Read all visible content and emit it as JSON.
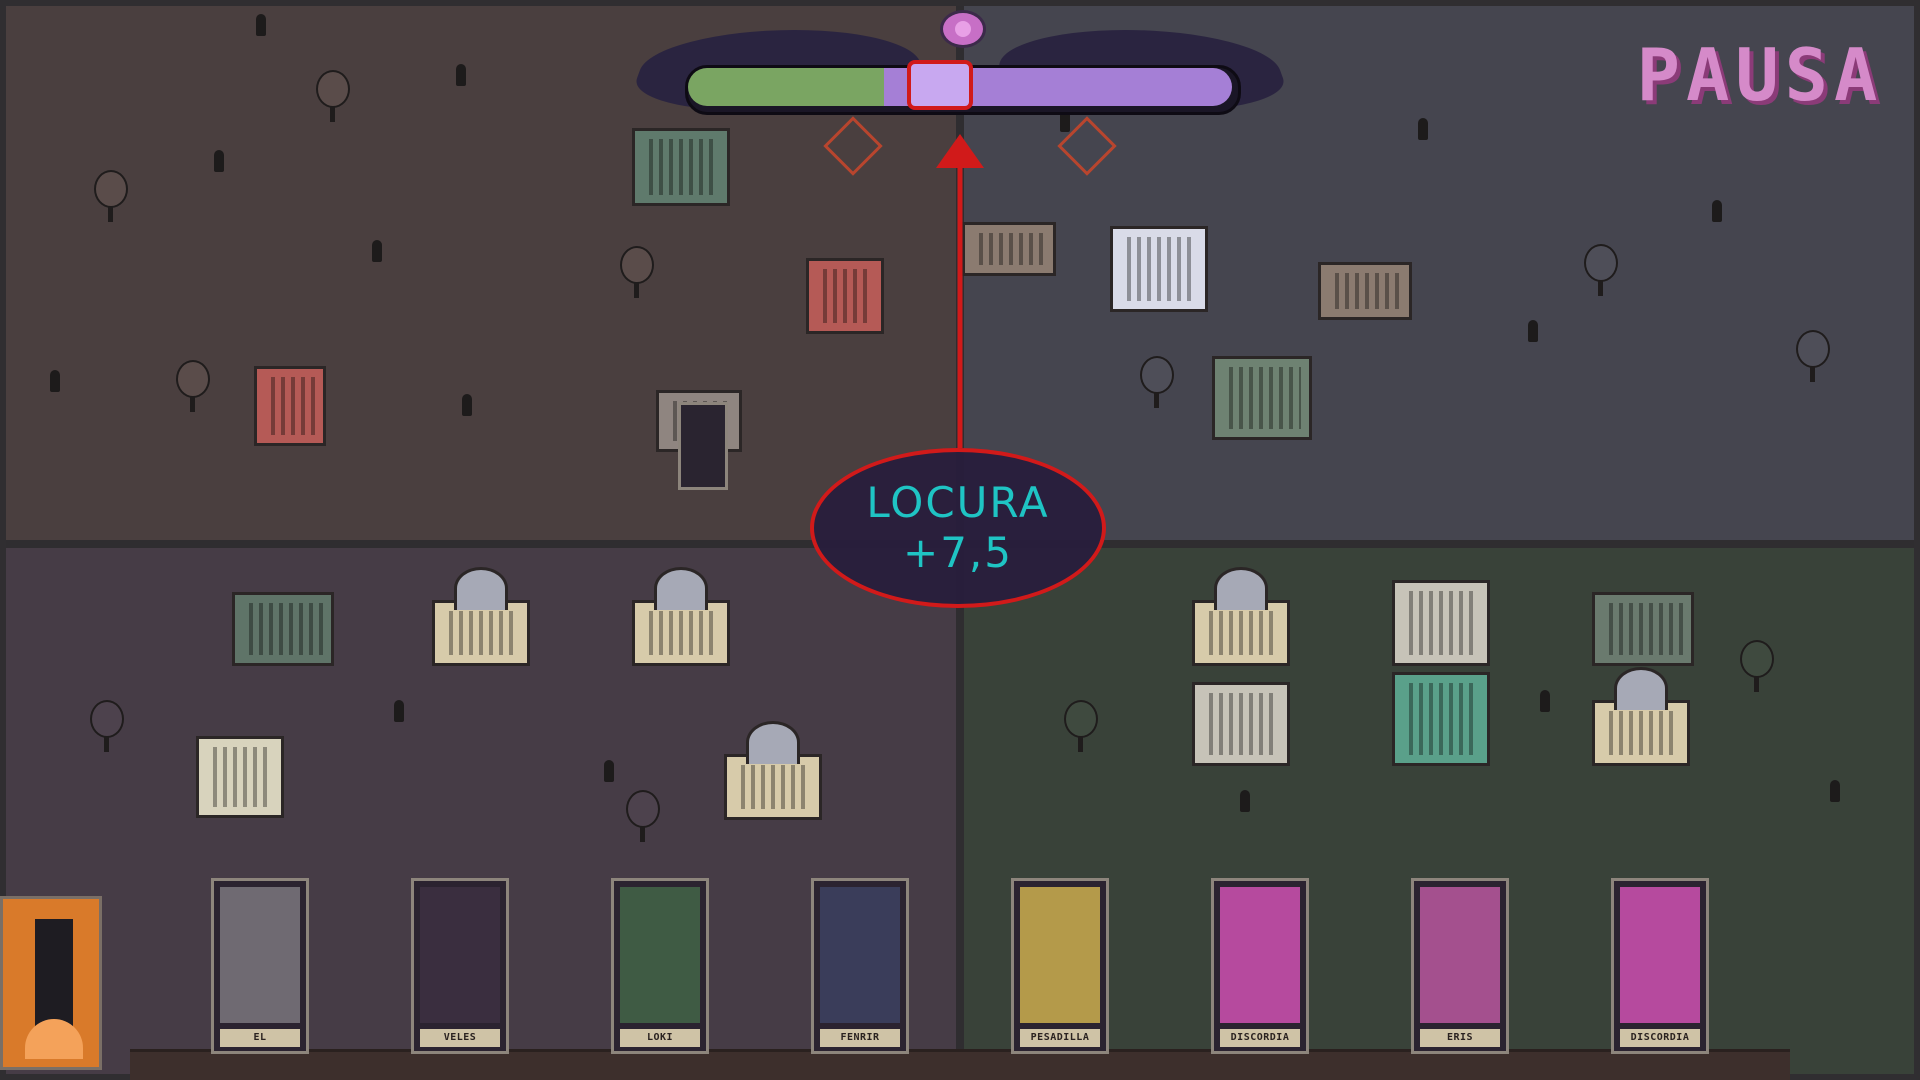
{
  "hud": {
    "pause_label": "PAUSA",
    "meter": {
      "green_fraction": 0.36,
      "purple_fraction": 0.64
    }
  },
  "callout": {
    "title": "LOCURA",
    "value": "+7,5"
  },
  "cards": [
    {
      "name": "EL TRANSCURSO",
      "color": "#6f6a72"
    },
    {
      "name": "VELES",
      "color": "#3a2e3f"
    },
    {
      "name": "LOKI",
      "color": "#3f5b44"
    },
    {
      "name": "FENRIR",
      "color": "#3a3d5a"
    },
    {
      "name": "PESADILLA",
      "color": "#b49a4a"
    },
    {
      "name": "DISCORDIA",
      "color": "#b64a9e"
    },
    {
      "name": "ERIS",
      "color": "#a4508e"
    },
    {
      "name": "DISCORDIA",
      "color": "#b64a9e"
    }
  ],
  "colors": {
    "accent_red": "#d11a1a",
    "callout_text": "#1fc4c4",
    "pause_pink": "#d58ac9"
  }
}
